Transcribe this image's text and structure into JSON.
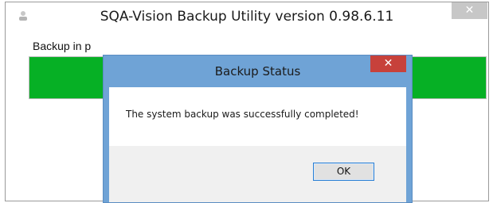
{
  "main_window": {
    "title": "SQA-Vision Backup Utility version 0.98.6.11",
    "close_glyph": "✕",
    "progress_label": "Backup in p",
    "progress_percent": 100
  },
  "dialog": {
    "title": "Backup Status",
    "close_glyph": "✕",
    "message": "The system backup was successfully completed!",
    "ok_label": "OK"
  },
  "colors": {
    "progress_green": "#06b025",
    "dialog_frame": "#6fa3d6",
    "dialog_close": "#c7413b"
  }
}
